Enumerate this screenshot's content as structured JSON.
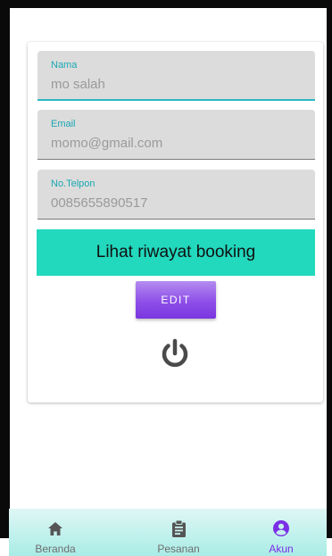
{
  "profile": {
    "name_label": "Nama",
    "name_value": "mo salah",
    "email_label": "Email",
    "email_value": "momo@gmail.com",
    "phone_label": "No.Telpon",
    "phone_value": "0085655890517"
  },
  "actions": {
    "history_label": "Lihat riwayat booking",
    "edit_label": "EDIT",
    "logout_icon": "power-icon"
  },
  "bottom_nav": {
    "items": [
      {
        "label": "Beranda",
        "icon": "home-icon",
        "active": false
      },
      {
        "label": "Pesanan",
        "icon": "clipboard-icon",
        "active": false
      },
      {
        "label": "Akun",
        "icon": "account-icon",
        "active": true
      }
    ]
  },
  "colors": {
    "accent_teal": "#22d8bd",
    "field_label": "#1aa7b3",
    "edit_purple": "#8e4fe8",
    "active_nav": "#7a2fe6"
  }
}
